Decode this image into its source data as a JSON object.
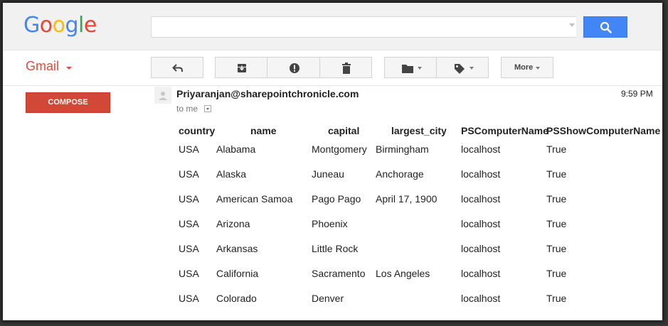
{
  "header": {
    "logo_letters": [
      {
        "ch": "G",
        "color": "#4285F4"
      },
      {
        "ch": "o",
        "color": "#EA4335"
      },
      {
        "ch": "o",
        "color": "#FBBC05"
      },
      {
        "ch": "g",
        "color": "#4285F4"
      },
      {
        "ch": "l",
        "color": "#34A853"
      },
      {
        "ch": "e",
        "color": "#EA4335"
      }
    ],
    "search": {
      "value": "",
      "placeholder": ""
    }
  },
  "toolbar": {
    "gmail_label": "Gmail",
    "more_label": "More"
  },
  "sidebar": {
    "compose_label": "COMPOSE"
  },
  "message": {
    "sender": "Priyaranjan@sharepointchronicle.com",
    "time": "9:59 PM",
    "recipient": "to me"
  },
  "table": {
    "headers": [
      "country",
      "name",
      "capital",
      "largest_city",
      "PSComputerName",
      "PSShowComputerName"
    ],
    "rows": [
      [
        "USA",
        "Alabama",
        "Montgomery",
        "Birmingham",
        "localhost",
        "True"
      ],
      [
        "USA",
        "Alaska",
        "Juneau",
        "Anchorage",
        "localhost",
        "True"
      ],
      [
        "USA",
        "American Samoa",
        "Pago Pago",
        "April 17, 1900",
        "localhost",
        "True"
      ],
      [
        "USA",
        "Arizona",
        "Phoenix",
        "",
        "localhost",
        "True"
      ],
      [
        "USA",
        "Arkansas",
        "Little Rock",
        "",
        "localhost",
        "True"
      ],
      [
        "USA",
        "California",
        "Sacramento",
        "Los Angeles",
        "localhost",
        "True"
      ],
      [
        "USA",
        "Colorado",
        "Denver",
        "",
        "localhost",
        "True"
      ]
    ]
  },
  "colors": {
    "search_button": "#4285f4",
    "compose_button": "#d14836",
    "gmail_label": "#dd4b39"
  }
}
